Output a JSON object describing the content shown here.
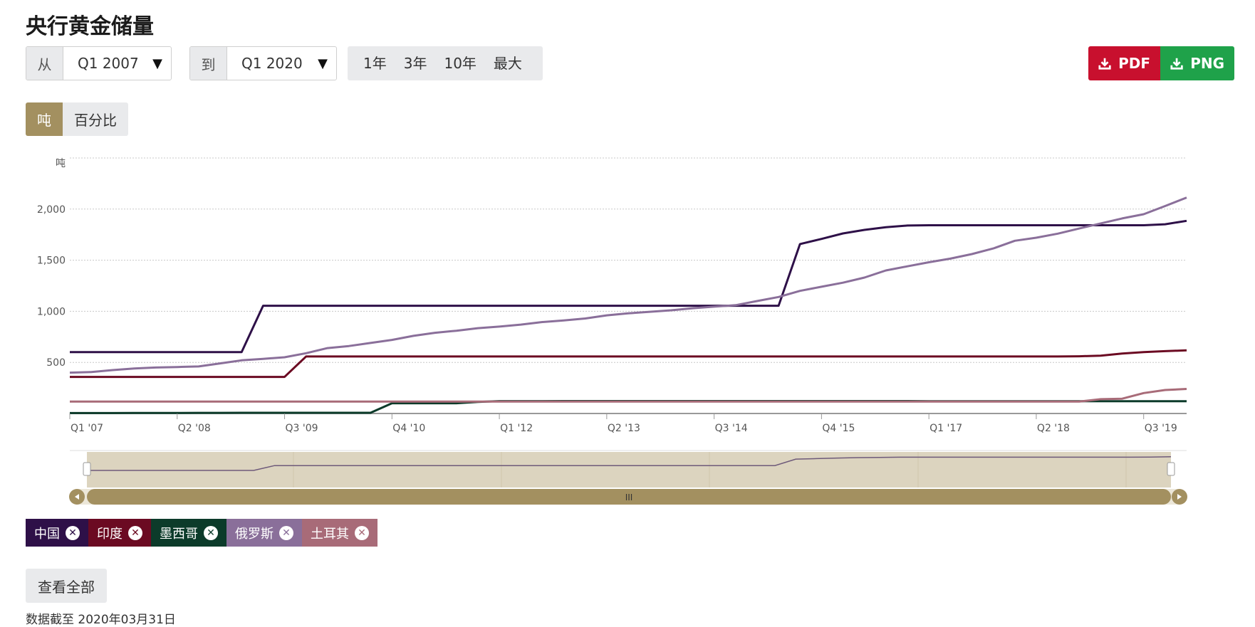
{
  "title": "央行黄金储量",
  "controls": {
    "from_prefix": "从",
    "from_value": "Q1 2007",
    "to_prefix": "到",
    "to_value": "Q1 2020",
    "caret": "▼",
    "periods": [
      "1年",
      "3年",
      "10年",
      "最大"
    ],
    "pdf_label": "PDF",
    "png_label": "PNG",
    "unit_tons": "吨",
    "unit_percent": "百分比"
  },
  "colors": {
    "china": "#2e1048",
    "india": "#6b0a22",
    "mexico": "#0c3b2a",
    "russia": "#8a6f9a",
    "turkey": "#a86b78",
    "gold": "#a39060",
    "pdf": "#c8102e",
    "png": "#1fa24a"
  },
  "chart_data": {
    "type": "line",
    "ylabel": "吨",
    "yticks": [
      500,
      1000,
      1500,
      2000
    ],
    "ytick_labels": [
      "500",
      "1,000",
      "1,500",
      "2,000"
    ],
    "ylim": [
      0,
      2500
    ],
    "xlim": [
      "Q1 2007",
      "Q1 2020"
    ],
    "xtick_labels": [
      "Q1 '07",
      "Q2 '08",
      "Q3 '09",
      "Q4 '10",
      "Q1 '12",
      "Q2 '13",
      "Q3 '14",
      "Q4 '15",
      "Q1 '17",
      "Q2 '18",
      "Q3 '19"
    ],
    "grid": true,
    "x": [
      "2007Q1",
      "2007Q2",
      "2007Q3",
      "2007Q4",
      "2008Q1",
      "2008Q2",
      "2008Q3",
      "2008Q4",
      "2009Q1",
      "2009Q2",
      "2009Q3",
      "2009Q4",
      "2010Q1",
      "2010Q2",
      "2010Q3",
      "2010Q4",
      "2011Q1",
      "2011Q2",
      "2011Q3",
      "2011Q4",
      "2012Q1",
      "2012Q2",
      "2012Q3",
      "2012Q4",
      "2013Q1",
      "2013Q2",
      "2013Q3",
      "2013Q4",
      "2014Q1",
      "2014Q2",
      "2014Q3",
      "2014Q4",
      "2015Q1",
      "2015Q2",
      "2015Q3",
      "2015Q4",
      "2016Q1",
      "2016Q2",
      "2016Q3",
      "2016Q4",
      "2017Q1",
      "2017Q2",
      "2017Q3",
      "2017Q4",
      "2018Q1",
      "2018Q2",
      "2018Q3",
      "2018Q4",
      "2019Q1",
      "2019Q2",
      "2019Q3",
      "2019Q4",
      "2020Q1"
    ],
    "series": [
      {
        "name": "中国",
        "color": "#2e1048",
        "values": [
          600,
          600,
          600,
          600,
          600,
          600,
          600,
          600,
          600,
          1054,
          1054,
          1054,
          1054,
          1054,
          1054,
          1054,
          1054,
          1054,
          1054,
          1054,
          1054,
          1054,
          1054,
          1054,
          1054,
          1054,
          1054,
          1054,
          1054,
          1054,
          1054,
          1054,
          1054,
          1054,
          1658,
          1708,
          1762,
          1797,
          1823,
          1839,
          1842,
          1842,
          1842,
          1842,
          1842,
          1842,
          1842,
          1842,
          1842,
          1842,
          1842,
          1852,
          1885,
          1926,
          1948,
          1948,
          1948
        ]
      },
      {
        "name": "印度",
        "color": "#6b0a22",
        "values": [
          358,
          358,
          358,
          358,
          358,
          358,
          358,
          358,
          358,
          358,
          358,
          558,
          558,
          558,
          558,
          558,
          558,
          558,
          558,
          558,
          558,
          558,
          558,
          558,
          558,
          558,
          558,
          558,
          558,
          558,
          558,
          558,
          558,
          558,
          558,
          558,
          558,
          558,
          558,
          558,
          558,
          558,
          558,
          558,
          558,
          558,
          558,
          560,
          566,
          587,
          600,
          610,
          618,
          618,
          625,
          640,
          653
        ]
      },
      {
        "name": "墨西哥",
        "color": "#0c3b2a",
        "values": [
          4,
          4,
          4,
          5,
          5,
          5,
          6,
          6,
          7,
          7,
          7,
          7,
          7,
          7,
          7,
          100,
          100,
          100,
          100,
          113,
          121,
          121,
          121,
          122,
          122,
          122,
          122,
          122,
          122,
          122,
          122,
          122,
          122,
          122,
          122,
          122,
          122,
          122,
          122,
          122,
          120,
          120,
          120,
          120,
          120,
          120,
          120,
          120,
          120,
          120,
          120,
          120,
          120,
          120,
          120,
          120,
          120
        ]
      },
      {
        "name": "俄罗斯",
        "color": "#8a6f9a",
        "values": [
          400,
          405,
          425,
          440,
          450,
          455,
          460,
          490,
          520,
          535,
          550,
          590,
          640,
          660,
          690,
          720,
          760,
          790,
          810,
          835,
          850,
          870,
          895,
          910,
          930,
          960,
          980,
          995,
          1010,
          1030,
          1045,
          1060,
          1100,
          1140,
          1200,
          1240,
          1280,
          1330,
          1400,
          1440,
          1480,
          1515,
          1560,
          1615,
          1690,
          1720,
          1760,
          1810,
          1860,
          1909,
          1950,
          2030,
          2113,
          2170,
          2219,
          2261,
          2299
        ]
      },
      {
        "name": "土耳其",
        "color": "#a86b78",
        "values": [
          116,
          116,
          116,
          116,
          116,
          116,
          116,
          116,
          116,
          116,
          116,
          116,
          116,
          116,
          116,
          116,
          116,
          116,
          116,
          116,
          116,
          116,
          116,
          116,
          116,
          116,
          116,
          116,
          116,
          116,
          116,
          116,
          116,
          116,
          116,
          116,
          116,
          116,
          116,
          116,
          116,
          116,
          116,
          116,
          116,
          116,
          116,
          116,
          140,
          145,
          200,
          230,
          240,
          255,
          250,
          290,
          320,
          385,
          410,
          600
        ]
      }
    ]
  },
  "navigator": {
    "handle_label": "III"
  },
  "view_all_label": "查看全部",
  "footnote": "数据截至 2020年03月31日"
}
